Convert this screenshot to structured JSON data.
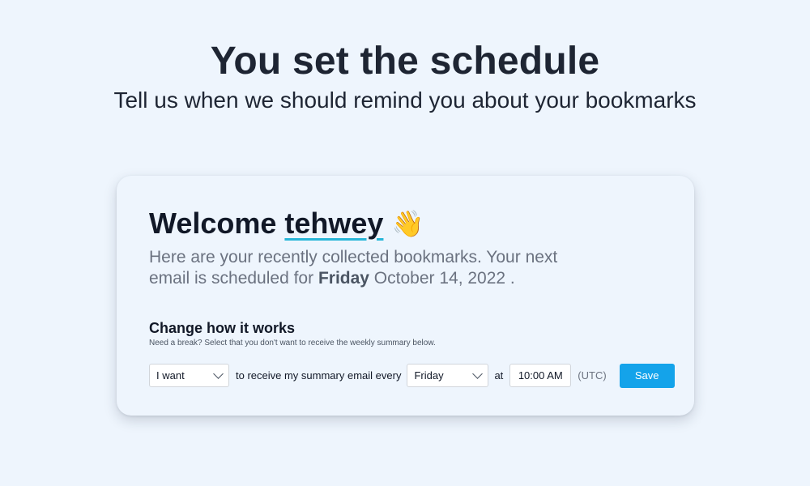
{
  "hero": {
    "title": "You set the schedule",
    "subtitle": "Tell us when we should remind you about your bookmarks"
  },
  "card": {
    "welcome_prefix": "Welcome",
    "username": "tehwey",
    "wave_emoji": "👋",
    "intro_text_1": "Here are your recently collected bookmarks. Your next email is scheduled for ",
    "next_day": "Friday",
    "next_date": " October 14, 2022 .",
    "section_title": "Change how it works",
    "section_hint": "Need a break? Select that you don't want to receive the weekly summary below.",
    "want_select_value": "I want",
    "connector_text": "to receive my summary email every",
    "day_select_value": "Friday",
    "at_label": "at",
    "time_value": "10:00 AM",
    "timezone_label": "(UTC)",
    "save_label": "Save"
  },
  "colors": {
    "background": "#eef5fd",
    "accent": "#14a3ea",
    "underline": "#29b6d8"
  },
  "icons": {
    "wave": "waving-hand-icon",
    "chevron": "chevron-down-icon"
  }
}
